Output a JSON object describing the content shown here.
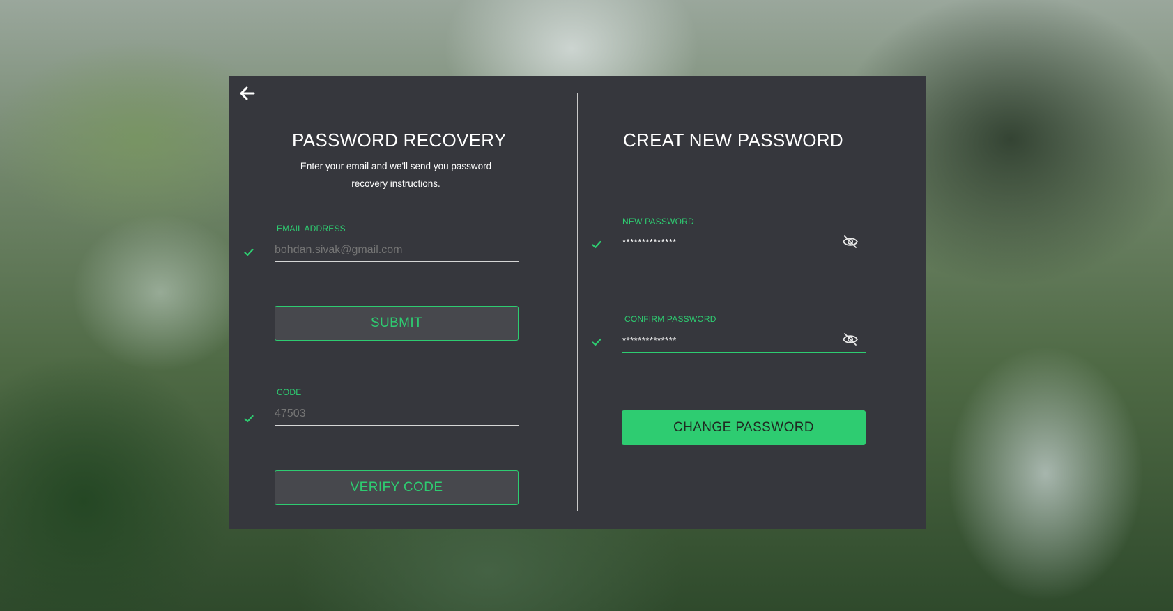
{
  "colors": {
    "accent": "#2ecc71",
    "panel": "#36373d",
    "button_bg": "#47484d",
    "text": "#ffffff",
    "muted": "#8f8f8f"
  },
  "icons": {
    "back": "arrow-left-icon",
    "check": "check-icon",
    "eye": "eye-off-icon"
  },
  "recovery": {
    "title": "PASSWORD RECOVERY",
    "subtitle_line1": "Enter your email and we'll send you password",
    "subtitle_line2": "recovery instructions.",
    "email_label": "EMAIL ADDRESS",
    "email_placeholder": "bohdan.sivak@gmail.com",
    "submit_label": "SUBMIT",
    "code_label": "CODE",
    "code_placeholder": "47503",
    "verify_label": "VERIFY CODE"
  },
  "new_password": {
    "title": "CREAT NEW PASSWORD",
    "new_label": "NEW PASSWORD",
    "new_value": "**************",
    "confirm_label": "CONFIRM PASSWORD",
    "confirm_value": "**************",
    "change_label": "CHANGE PASSWORD"
  }
}
